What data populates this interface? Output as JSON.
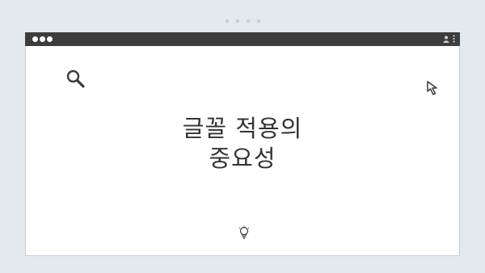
{
  "window": {
    "title_line1": "글꼴 적용의",
    "title_line2": "중요성"
  },
  "icons": {
    "top": "pager-dots",
    "titlebar_left": "window-controls",
    "titlebar_right": [
      "user-icon",
      "more-vertical-icon"
    ],
    "content": [
      "search-icon",
      "cursor-arrow-icon",
      "lightbulb-icon"
    ]
  },
  "colors": {
    "background": "#e4e9ee",
    "titlebar": "#3d3d3d",
    "text": "#333333"
  }
}
